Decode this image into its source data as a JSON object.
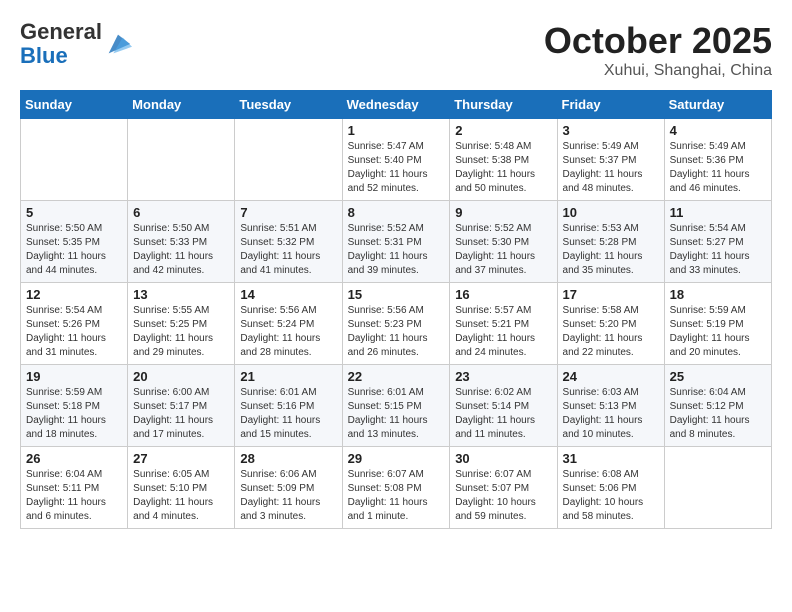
{
  "header": {
    "logo_general": "General",
    "logo_blue": "Blue",
    "month_title": "October 2025",
    "subtitle": "Xuhui, Shanghai, China"
  },
  "weekdays": [
    "Sunday",
    "Monday",
    "Tuesday",
    "Wednesday",
    "Thursday",
    "Friday",
    "Saturday"
  ],
  "weeks": [
    [
      {
        "day": "",
        "info": ""
      },
      {
        "day": "",
        "info": ""
      },
      {
        "day": "",
        "info": ""
      },
      {
        "day": "1",
        "info": "Sunrise: 5:47 AM\nSunset: 5:40 PM\nDaylight: 11 hours\nand 52 minutes."
      },
      {
        "day": "2",
        "info": "Sunrise: 5:48 AM\nSunset: 5:38 PM\nDaylight: 11 hours\nand 50 minutes."
      },
      {
        "day": "3",
        "info": "Sunrise: 5:49 AM\nSunset: 5:37 PM\nDaylight: 11 hours\nand 48 minutes."
      },
      {
        "day": "4",
        "info": "Sunrise: 5:49 AM\nSunset: 5:36 PM\nDaylight: 11 hours\nand 46 minutes."
      }
    ],
    [
      {
        "day": "5",
        "info": "Sunrise: 5:50 AM\nSunset: 5:35 PM\nDaylight: 11 hours\nand 44 minutes."
      },
      {
        "day": "6",
        "info": "Sunrise: 5:50 AM\nSunset: 5:33 PM\nDaylight: 11 hours\nand 42 minutes."
      },
      {
        "day": "7",
        "info": "Sunrise: 5:51 AM\nSunset: 5:32 PM\nDaylight: 11 hours\nand 41 minutes."
      },
      {
        "day": "8",
        "info": "Sunrise: 5:52 AM\nSunset: 5:31 PM\nDaylight: 11 hours\nand 39 minutes."
      },
      {
        "day": "9",
        "info": "Sunrise: 5:52 AM\nSunset: 5:30 PM\nDaylight: 11 hours\nand 37 minutes."
      },
      {
        "day": "10",
        "info": "Sunrise: 5:53 AM\nSunset: 5:28 PM\nDaylight: 11 hours\nand 35 minutes."
      },
      {
        "day": "11",
        "info": "Sunrise: 5:54 AM\nSunset: 5:27 PM\nDaylight: 11 hours\nand 33 minutes."
      }
    ],
    [
      {
        "day": "12",
        "info": "Sunrise: 5:54 AM\nSunset: 5:26 PM\nDaylight: 11 hours\nand 31 minutes."
      },
      {
        "day": "13",
        "info": "Sunrise: 5:55 AM\nSunset: 5:25 PM\nDaylight: 11 hours\nand 29 minutes."
      },
      {
        "day": "14",
        "info": "Sunrise: 5:56 AM\nSunset: 5:24 PM\nDaylight: 11 hours\nand 28 minutes."
      },
      {
        "day": "15",
        "info": "Sunrise: 5:56 AM\nSunset: 5:23 PM\nDaylight: 11 hours\nand 26 minutes."
      },
      {
        "day": "16",
        "info": "Sunrise: 5:57 AM\nSunset: 5:21 PM\nDaylight: 11 hours\nand 24 minutes."
      },
      {
        "day": "17",
        "info": "Sunrise: 5:58 AM\nSunset: 5:20 PM\nDaylight: 11 hours\nand 22 minutes."
      },
      {
        "day": "18",
        "info": "Sunrise: 5:59 AM\nSunset: 5:19 PM\nDaylight: 11 hours\nand 20 minutes."
      }
    ],
    [
      {
        "day": "19",
        "info": "Sunrise: 5:59 AM\nSunset: 5:18 PM\nDaylight: 11 hours\nand 18 minutes."
      },
      {
        "day": "20",
        "info": "Sunrise: 6:00 AM\nSunset: 5:17 PM\nDaylight: 11 hours\nand 17 minutes."
      },
      {
        "day": "21",
        "info": "Sunrise: 6:01 AM\nSunset: 5:16 PM\nDaylight: 11 hours\nand 15 minutes."
      },
      {
        "day": "22",
        "info": "Sunrise: 6:01 AM\nSunset: 5:15 PM\nDaylight: 11 hours\nand 13 minutes."
      },
      {
        "day": "23",
        "info": "Sunrise: 6:02 AM\nSunset: 5:14 PM\nDaylight: 11 hours\nand 11 minutes."
      },
      {
        "day": "24",
        "info": "Sunrise: 6:03 AM\nSunset: 5:13 PM\nDaylight: 11 hours\nand 10 minutes."
      },
      {
        "day": "25",
        "info": "Sunrise: 6:04 AM\nSunset: 5:12 PM\nDaylight: 11 hours\nand 8 minutes."
      }
    ],
    [
      {
        "day": "26",
        "info": "Sunrise: 6:04 AM\nSunset: 5:11 PM\nDaylight: 11 hours\nand 6 minutes."
      },
      {
        "day": "27",
        "info": "Sunrise: 6:05 AM\nSunset: 5:10 PM\nDaylight: 11 hours\nand 4 minutes."
      },
      {
        "day": "28",
        "info": "Sunrise: 6:06 AM\nSunset: 5:09 PM\nDaylight: 11 hours\nand 3 minutes."
      },
      {
        "day": "29",
        "info": "Sunrise: 6:07 AM\nSunset: 5:08 PM\nDaylight: 11 hours\nand 1 minute."
      },
      {
        "day": "30",
        "info": "Sunrise: 6:07 AM\nSunset: 5:07 PM\nDaylight: 10 hours\nand 59 minutes."
      },
      {
        "day": "31",
        "info": "Sunrise: 6:08 AM\nSunset: 5:06 PM\nDaylight: 10 hours\nand 58 minutes."
      },
      {
        "day": "",
        "info": ""
      }
    ]
  ]
}
